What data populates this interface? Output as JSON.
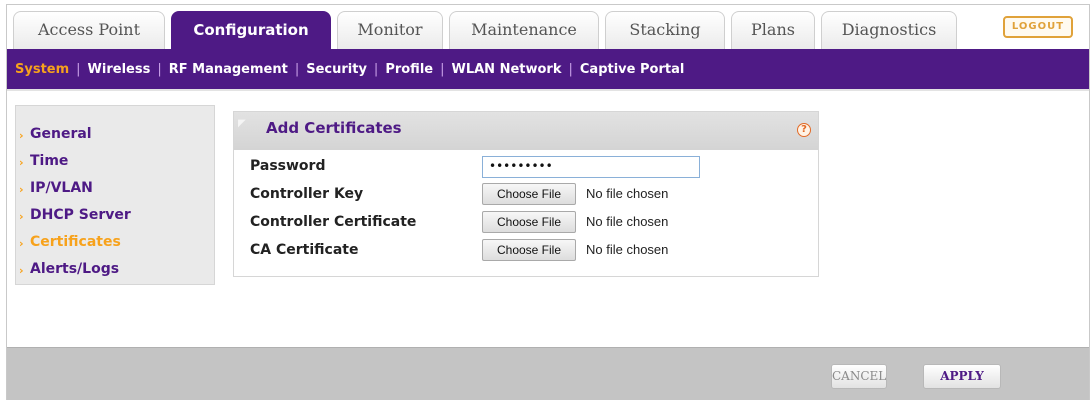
{
  "tabs": [
    {
      "label": "Access Point",
      "active": false
    },
    {
      "label": "Configuration",
      "active": true
    },
    {
      "label": "Monitor",
      "active": false
    },
    {
      "label": "Maintenance",
      "active": false
    },
    {
      "label": "Stacking",
      "active": false
    },
    {
      "label": "Plans",
      "active": false
    },
    {
      "label": "Diagnostics",
      "active": false
    }
  ],
  "logout_label": "LOGOUT",
  "subnav": [
    {
      "label": "System",
      "active": true
    },
    {
      "label": "Wireless",
      "active": false
    },
    {
      "label": "RF Management",
      "active": false
    },
    {
      "label": "Security",
      "active": false
    },
    {
      "label": "Profile",
      "active": false
    },
    {
      "label": "WLAN Network",
      "active": false
    },
    {
      "label": "Captive Portal",
      "active": false
    }
  ],
  "sidemenu": [
    {
      "label": "General",
      "active": false
    },
    {
      "label": "Time",
      "active": false
    },
    {
      "label": "IP/VLAN",
      "active": false
    },
    {
      "label": "DHCP Server",
      "active": false
    },
    {
      "label": "Certificates",
      "active": true
    },
    {
      "label": "Alerts/Logs",
      "active": false
    }
  ],
  "panel": {
    "title": "Add Certificates",
    "help_icon": "?",
    "password": {
      "label": "Password",
      "value": "•••••••••"
    },
    "files": [
      {
        "label": "Controller Key",
        "button": "Choose File",
        "status": "No file chosen"
      },
      {
        "label": "Controller Certificate",
        "button": "Choose File",
        "status": "No file chosen"
      },
      {
        "label": "CA Certificate",
        "button": "Choose File",
        "status": "No file chosen"
      }
    ]
  },
  "footer": {
    "cancel_label": "CANCEL",
    "apply_label": "APPLY"
  },
  "colors": {
    "brand_purple": "#4e1a85",
    "accent_orange": "#f7a21c"
  }
}
